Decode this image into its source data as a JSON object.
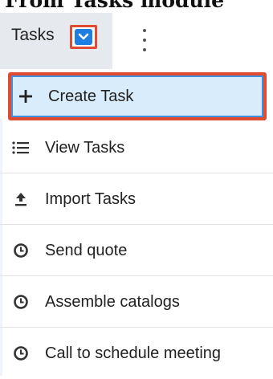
{
  "caption": "From Tasks module",
  "toolbar": {
    "tab_label": "Tasks"
  },
  "menu": {
    "items": [
      {
        "label": "Create Task",
        "icon": "plus-icon"
      },
      {
        "label": "View Tasks",
        "icon": "list-icon"
      },
      {
        "label": "Import Tasks",
        "icon": "upload-icon"
      },
      {
        "label": "Send quote",
        "icon": "clock-icon"
      },
      {
        "label": "Assemble catalogs",
        "icon": "clock-icon"
      },
      {
        "label": "Call to schedule meeting",
        "icon": "clock-icon"
      }
    ]
  },
  "colors": {
    "highlight_border": "#e14b32",
    "selected_bg": "#d9ecfb",
    "accent_blue": "#1e7fe0",
    "tab_bg": "#e6e9ee"
  }
}
